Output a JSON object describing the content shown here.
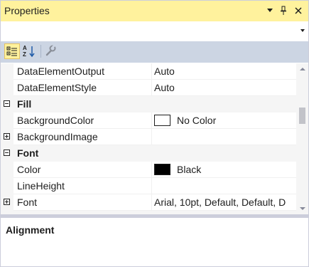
{
  "window": {
    "title": "Properties"
  },
  "titlebar_buttons": {
    "dropdown_glyph": "▼",
    "pin_glyph": "📌",
    "close_glyph": "✕"
  },
  "toolbar": {
    "categorized_icon": "categorized-icon",
    "alphabetical_icon": "alphabetical-icon",
    "property_pages_icon": "wrench-icon"
  },
  "properties": {
    "rows": [
      {
        "name": "DataElementOutput",
        "value": "Auto"
      },
      {
        "name": "DataElementStyle",
        "value": "Auto"
      },
      {
        "category": "Fill",
        "expanded": true
      },
      {
        "name": "BackgroundColor",
        "value": "No Color",
        "swatch": "#ffffff"
      },
      {
        "name": "BackgroundImage",
        "value": "",
        "expandable": true
      },
      {
        "category": "Font",
        "expanded": true
      },
      {
        "name": "Color",
        "value": "Black",
        "swatch": "#000000"
      },
      {
        "name": "LineHeight",
        "value": ""
      },
      {
        "name": "Font",
        "value": "Arial, 10pt, Default, Default, D",
        "expandable": true
      }
    ]
  },
  "help": {
    "title": "Alignment",
    "description": ""
  },
  "colors": {
    "title_bar": "#fff29d",
    "toolbar": "#ccd5e3",
    "category_row": "#f5f5f5"
  }
}
